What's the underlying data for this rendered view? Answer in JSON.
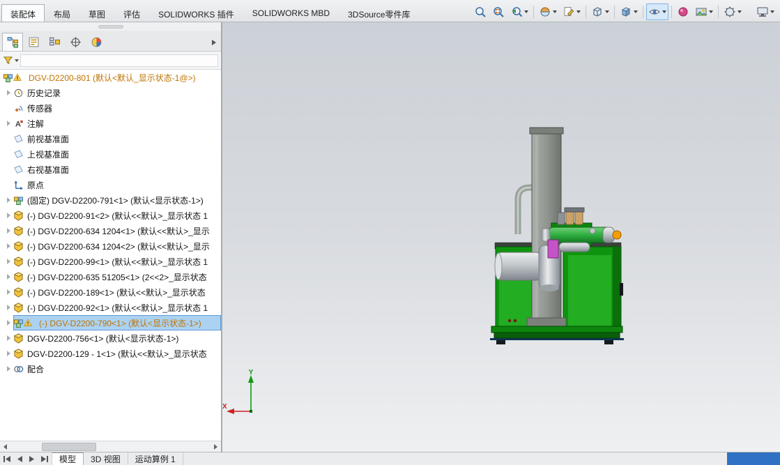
{
  "ribbon": {
    "tabs": [
      {
        "label": "装配体",
        "active": true
      },
      {
        "label": "布局",
        "active": false
      },
      {
        "label": "草图",
        "active": false
      },
      {
        "label": "评估",
        "active": false
      },
      {
        "label": "SOLIDWORKS 插件",
        "active": false
      },
      {
        "label": "SOLIDWORKS MBD",
        "active": false
      },
      {
        "label": "3DSource零件库",
        "active": false
      }
    ]
  },
  "view_toolbar": {
    "buttons": [
      {
        "name": "zoom-fit",
        "dropdown": false,
        "sep": false,
        "pressed": false,
        "gap": false
      },
      {
        "name": "zoom-area",
        "dropdown": false,
        "sep": false,
        "pressed": false,
        "gap": false
      },
      {
        "name": "previous-view",
        "dropdown": true,
        "sep": true,
        "pressed": false,
        "gap": false
      },
      {
        "name": "section-view",
        "dropdown": true,
        "sep": false,
        "pressed": false,
        "gap": false
      },
      {
        "name": "annotation-view",
        "dropdown": true,
        "sep": true,
        "pressed": false,
        "gap": false
      },
      {
        "name": "view-orientation",
        "dropdown": true,
        "sep": true,
        "pressed": false,
        "gap": false
      },
      {
        "name": "display-style",
        "dropdown": true,
        "sep": true,
        "pressed": false,
        "gap": false
      },
      {
        "name": "hide-show-items",
        "dropdown": true,
        "sep": true,
        "pressed": true,
        "gap": false
      },
      {
        "name": "edit-appearance",
        "dropdown": false,
        "sep": false,
        "pressed": false,
        "gap": false
      },
      {
        "name": "apply-scene",
        "dropdown": true,
        "sep": true,
        "pressed": false,
        "gap": false
      },
      {
        "name": "view-settings",
        "dropdown": true,
        "sep": false,
        "pressed": false,
        "gap": false
      },
      {
        "name": "monitor",
        "dropdown": true,
        "sep": false,
        "pressed": false,
        "gap": true
      }
    ]
  },
  "panel": {
    "tabs": [
      {
        "name": "feature-manager",
        "active": true
      },
      {
        "name": "property-manager",
        "active": false
      },
      {
        "name": "configuration-manager",
        "active": false
      },
      {
        "name": "dimxpert-manager",
        "active": false
      },
      {
        "name": "display-manager",
        "active": false
      }
    ],
    "filter": {
      "value": "",
      "placeholder": ""
    }
  },
  "tree": {
    "items": [
      {
        "label": "DGV-D2200-801 (默认<默认_显示状态-1@>)",
        "icon": "assembly",
        "indent": 0,
        "expandable": false,
        "warning": true,
        "selected": false,
        "warn_text": true
      },
      {
        "label": "历史记录",
        "icon": "history",
        "indent": 1,
        "expandable": true,
        "warning": false,
        "selected": false,
        "warn_text": false
      },
      {
        "label": "传感器",
        "icon": "sensor",
        "indent": 1,
        "expandable": false,
        "warning": false,
        "selected": false,
        "warn_text": false
      },
      {
        "label": "注解",
        "icon": "annotation",
        "indent": 1,
        "expandable": true,
        "warning": false,
        "selected": false,
        "warn_text": false
      },
      {
        "label": "前视基准面",
        "icon": "plane",
        "indent": 1,
        "expandable": false,
        "warning": false,
        "selected": false,
        "warn_text": false
      },
      {
        "label": "上视基准面",
        "icon": "plane",
        "indent": 1,
        "expandable": false,
        "warning": false,
        "selected": false,
        "warn_text": false
      },
      {
        "label": "右视基准面",
        "icon": "plane",
        "indent": 1,
        "expandable": false,
        "warning": false,
        "selected": false,
        "warn_text": false
      },
      {
        "label": "原点",
        "icon": "origin",
        "indent": 1,
        "expandable": false,
        "warning": false,
        "selected": false,
        "warn_text": false
      },
      {
        "label": "(固定) DGV-D2200-791<1> (默认<显示状态-1>)",
        "icon": "assembly",
        "indent": 1,
        "expandable": true,
        "warning": false,
        "selected": false,
        "warn_text": false
      },
      {
        "label": "(-) DGV-D2200-91<2> (默认<<默认>_显示状态 1",
        "icon": "part",
        "indent": 1,
        "expandable": true,
        "warning": false,
        "selected": false,
        "warn_text": false
      },
      {
        "label": "(-) DGV-D2200-634 1204<1> (默认<<默认>_显示",
        "icon": "part",
        "indent": 1,
        "expandable": true,
        "warning": false,
        "selected": false,
        "warn_text": false
      },
      {
        "label": "(-) DGV-D2200-634 1204<2> (默认<<默认>_显示",
        "icon": "part",
        "indent": 1,
        "expandable": true,
        "warning": false,
        "selected": false,
        "warn_text": false
      },
      {
        "label": "(-) DGV-D2200-99<1> (默认<<默认>_显示状态 1",
        "icon": "part",
        "indent": 1,
        "expandable": true,
        "warning": false,
        "selected": false,
        "warn_text": false
      },
      {
        "label": "(-) DGV-D2200-635 51205<1> (2<<2>_显示状态",
        "icon": "part",
        "indent": 1,
        "expandable": true,
        "warning": false,
        "selected": false,
        "warn_text": false
      },
      {
        "label": "(-) DGV-D2200-189<1> (默认<<默认>_显示状态",
        "icon": "part",
        "indent": 1,
        "expandable": true,
        "warning": false,
        "selected": false,
        "warn_text": false
      },
      {
        "label": "(-) DGV-D2200-92<1> (默认<<默认>_显示状态 1",
        "icon": "part",
        "indent": 1,
        "expandable": true,
        "warning": false,
        "selected": false,
        "warn_text": false
      },
      {
        "label": "(-) DGV-D2200-790<1> (默认<显示状态-1>)",
        "icon": "assembly",
        "indent": 1,
        "expandable": true,
        "warning": true,
        "selected": true,
        "warn_text": true
      },
      {
        "label": "DGV-D2200-756<1> (默认<显示状态-1>)",
        "icon": "part",
        "indent": 1,
        "expandable": true,
        "warning": false,
        "selected": false,
        "warn_text": false
      },
      {
        "label": "DGV-D2200-129 - 1<1> (默认<<默认>_显示状态",
        "icon": "part",
        "indent": 1,
        "expandable": true,
        "warning": false,
        "selected": false,
        "warn_text": false
      },
      {
        "label": "配合",
        "icon": "mates",
        "indent": 1,
        "expandable": true,
        "warning": false,
        "selected": false,
        "warn_text": false
      }
    ]
  },
  "viewport": {
    "triad": {
      "x_label": "X",
      "y_label": "Y"
    }
  },
  "statusbar": {
    "tabs": [
      {
        "label": "模型",
        "active": true
      },
      {
        "label": "3D 视图",
        "active": false
      },
      {
        "label": "运动算例 1",
        "active": false
      }
    ]
  },
  "colors": {
    "selection_bg": "#acd2f2",
    "selection_border": "#5a9bd5",
    "warning_text": "#bf7300",
    "triad_x": "#cc2222",
    "triad_y": "#109a10",
    "status_blue": "#2f72c5"
  }
}
